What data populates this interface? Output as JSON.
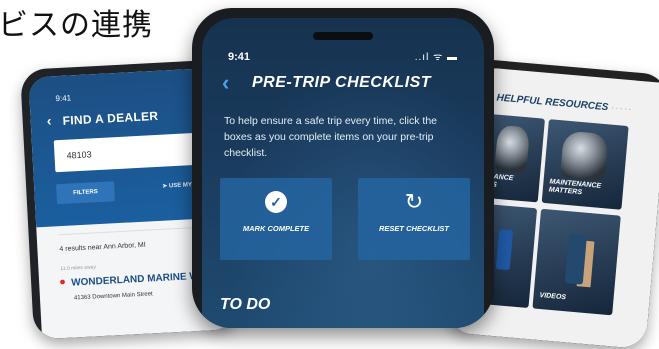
{
  "heading": "ビスの連携",
  "left_phone": {
    "time": "9:41",
    "back_icon": "‹",
    "title": "FIND A DEALER",
    "zip_value": "48103",
    "filters_label": "FILTERS",
    "use_my_location_label": "USE MY",
    "results_text": "4 results near Ann Arbor, MI",
    "distance_text": "11.0 miles away",
    "dealer_name": "WONDERLAND MARINE W",
    "dealer_address": "41363 Downtown Main Street"
  },
  "center_phone": {
    "time": "9:41",
    "status_icons": "..ıl ᯤ ▬",
    "title": "PRE-TRIP CHECKLIST",
    "intro": "To help ensure a safe trip every time, click the boxes as you complete items on your pre-trip checklist.",
    "mark_complete_label": "MARK COMPLETE",
    "reset_checklist_label": "RESET CHECKLIST",
    "todo_label": "TO DO"
  },
  "right_phone": {
    "title": "HELPFUL RESOURCES",
    "tiles": [
      {
        "caption": "MANCE\nNS"
      },
      {
        "caption": "MAINTENANCE\nMATTERS"
      },
      {
        "caption": ""
      },
      {
        "caption": "VIDEOS"
      }
    ]
  },
  "colors": {
    "brand_blue": "#1c4f83",
    "accent_blue": "#48a3e8",
    "pin_red": "#d42d2d"
  }
}
